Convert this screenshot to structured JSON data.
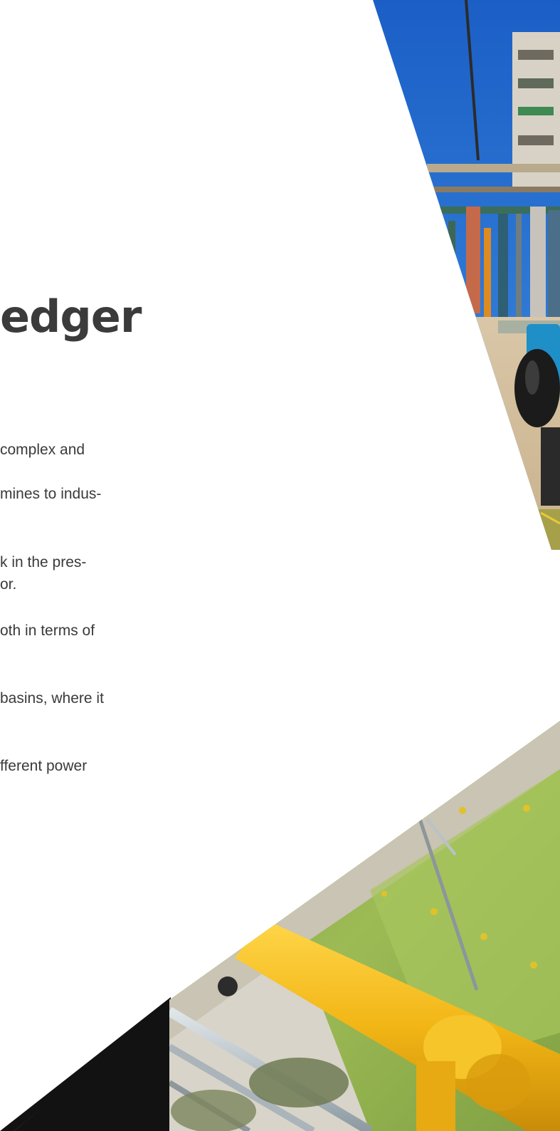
{
  "heading": "edger",
  "paragraph_lines": [
    "complex and",
    "mines to indus-",
    "k in the pres-",
    "or.",
    "oth in terms of",
    "basins, where it",
    "fferent power"
  ],
  "colors": {
    "heading": "#3b3b3b",
    "body_text": "#3a3a3a",
    "sky": "#1f6fd0",
    "dark_corner": "#121212",
    "yellow_pipe": "#f2b616",
    "basin_green": "#8fb04a"
  }
}
